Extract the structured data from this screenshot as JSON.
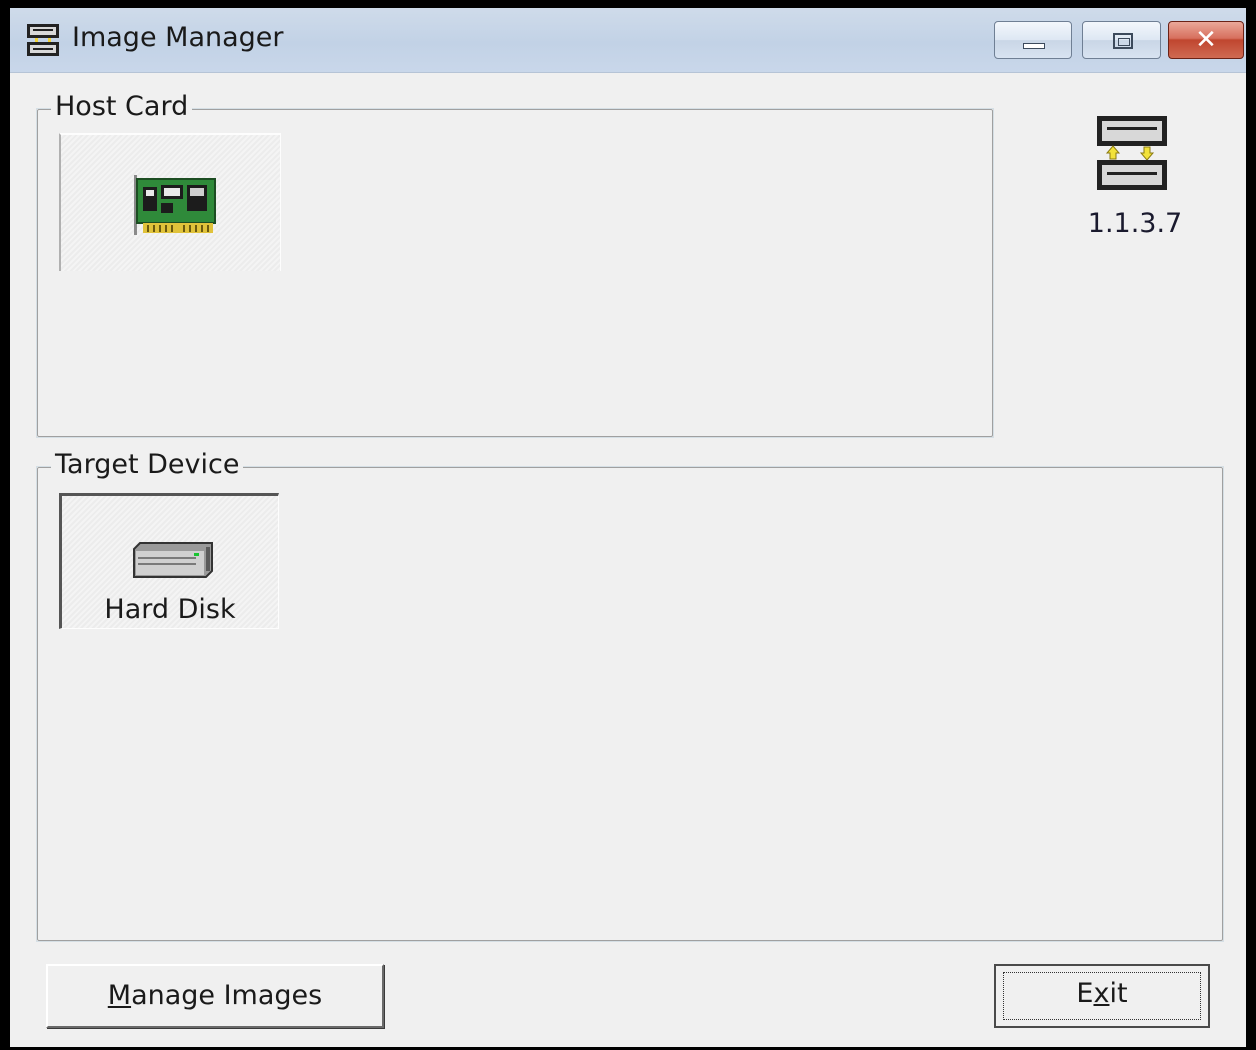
{
  "window": {
    "title": "Image Manager",
    "icon": "server-pair-icon",
    "controls": [
      "minimize-icon",
      "maximize-icon",
      "close-icon"
    ],
    "close_glyph": "✕"
  },
  "host_card": {
    "label": "Host Card",
    "item_icon": "expansion-card-icon"
  },
  "target_device": {
    "label": "Target Device",
    "item_label": "Hard Disk",
    "item_icon": "hard-disk-icon"
  },
  "version": {
    "text": "1.1.3.7",
    "icon": "server-sync-icon"
  },
  "buttons": {
    "manage_prefix": "M",
    "manage_rest": "anage Images",
    "exit_prefix": "E",
    "exit_mid": "x",
    "exit_rest": "it"
  },
  "colors": {
    "titlebar": "#c6d5e8",
    "close_button": "#c8503a",
    "dialog_background": "#f0f0f0"
  }
}
